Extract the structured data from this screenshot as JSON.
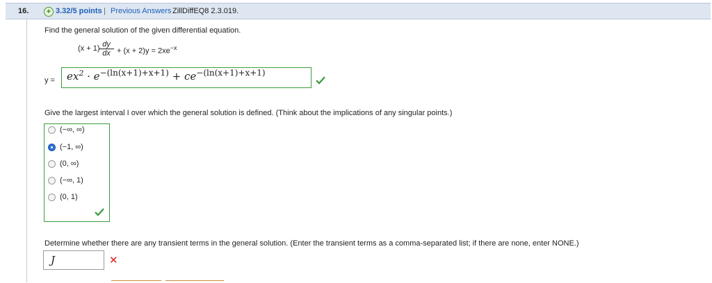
{
  "header": {
    "question_number": "16.",
    "points": "3.32/5 points",
    "separator": "|",
    "previous_answers": "Previous Answers",
    "question_id": "ZillDiffEQ8 2.3.019."
  },
  "problem": {
    "prompt": "Find the general solution of the given differential equation.",
    "equation_left": "(x + 1)",
    "dy": "dy",
    "dx": "dx",
    "equation_right": "+ (x + 2)y = 2xe",
    "equation_exp": "−x"
  },
  "answer1": {
    "label": "y =",
    "expr_part1": "ex",
    "expr_sup1": "2",
    "expr_part2": "· e",
    "expr_exp1": "−(ln(x+1)+x+1)",
    "expr_part3": "+ ce",
    "expr_exp2": "−(ln(x+1)+x+1)",
    "status": "correct"
  },
  "question2": {
    "prompt": "Give the largest interval I over which the general solution is defined. (Think about the implications of any singular points.)",
    "options": [
      "(−∞, ∞)",
      "(−1, ∞)",
      "(0, ∞)",
      "(−∞, 1)",
      "(0, 1)"
    ],
    "selected_index": 1,
    "status": "correct"
  },
  "question3": {
    "prompt": "Determine whether there are any transient terms in the general solution. (Enter the transient terms as a comma-separated list; if there are none, enter NONE.)",
    "input_value": "J",
    "status": "incorrect"
  },
  "colors": {
    "correct": "#3a9b3a",
    "incorrect": "#e02020",
    "link": "#1f5fb8",
    "header_bg": "#dde6f1"
  }
}
